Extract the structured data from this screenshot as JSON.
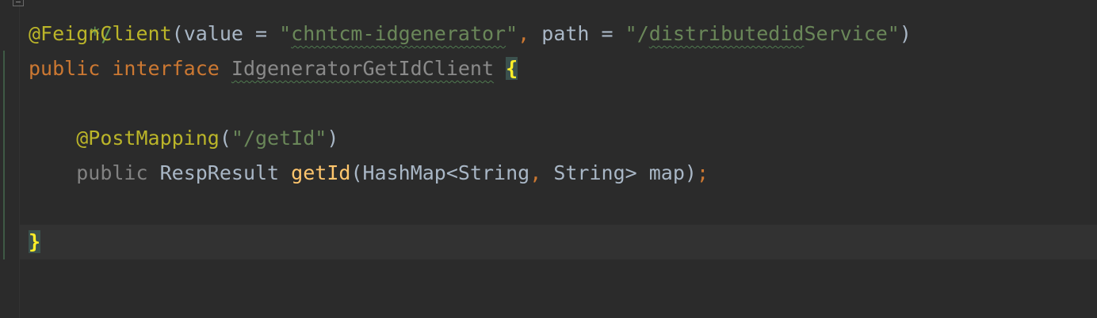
{
  "editor": {
    "comment_tail": "*/",
    "line_annotation": {
      "annotation": "@FeignClient",
      "open": "(",
      "value_key": "value",
      "eq1": " = ",
      "value_quote_open": "\"",
      "value_str": "chntcm-idgenerator",
      "value_quote_close": "\"",
      "comma": ", ",
      "path_key": "path",
      "eq2": " = ",
      "path_str_pre": "\"/",
      "path_str_squiggle": "distributedid",
      "path_str_post": "Service\"",
      "close": ")"
    },
    "line_interface": {
      "kw_public": "public",
      "kw_interface": "interface",
      "name": "IdgeneratorGetIdClient",
      "open_brace": "{"
    },
    "line_mapping": {
      "annotation": "@PostMapping",
      "open": "(",
      "str": "\"/getId\"",
      "close": ")"
    },
    "line_method": {
      "kw_public": "public",
      "return_type": "RespResult",
      "method": "getId",
      "params_pre": "(HashMap<String",
      "comma": ",",
      "params_post": " String> map)",
      "semicolon": ";"
    },
    "line_close": {
      "close_brace": "}"
    }
  }
}
